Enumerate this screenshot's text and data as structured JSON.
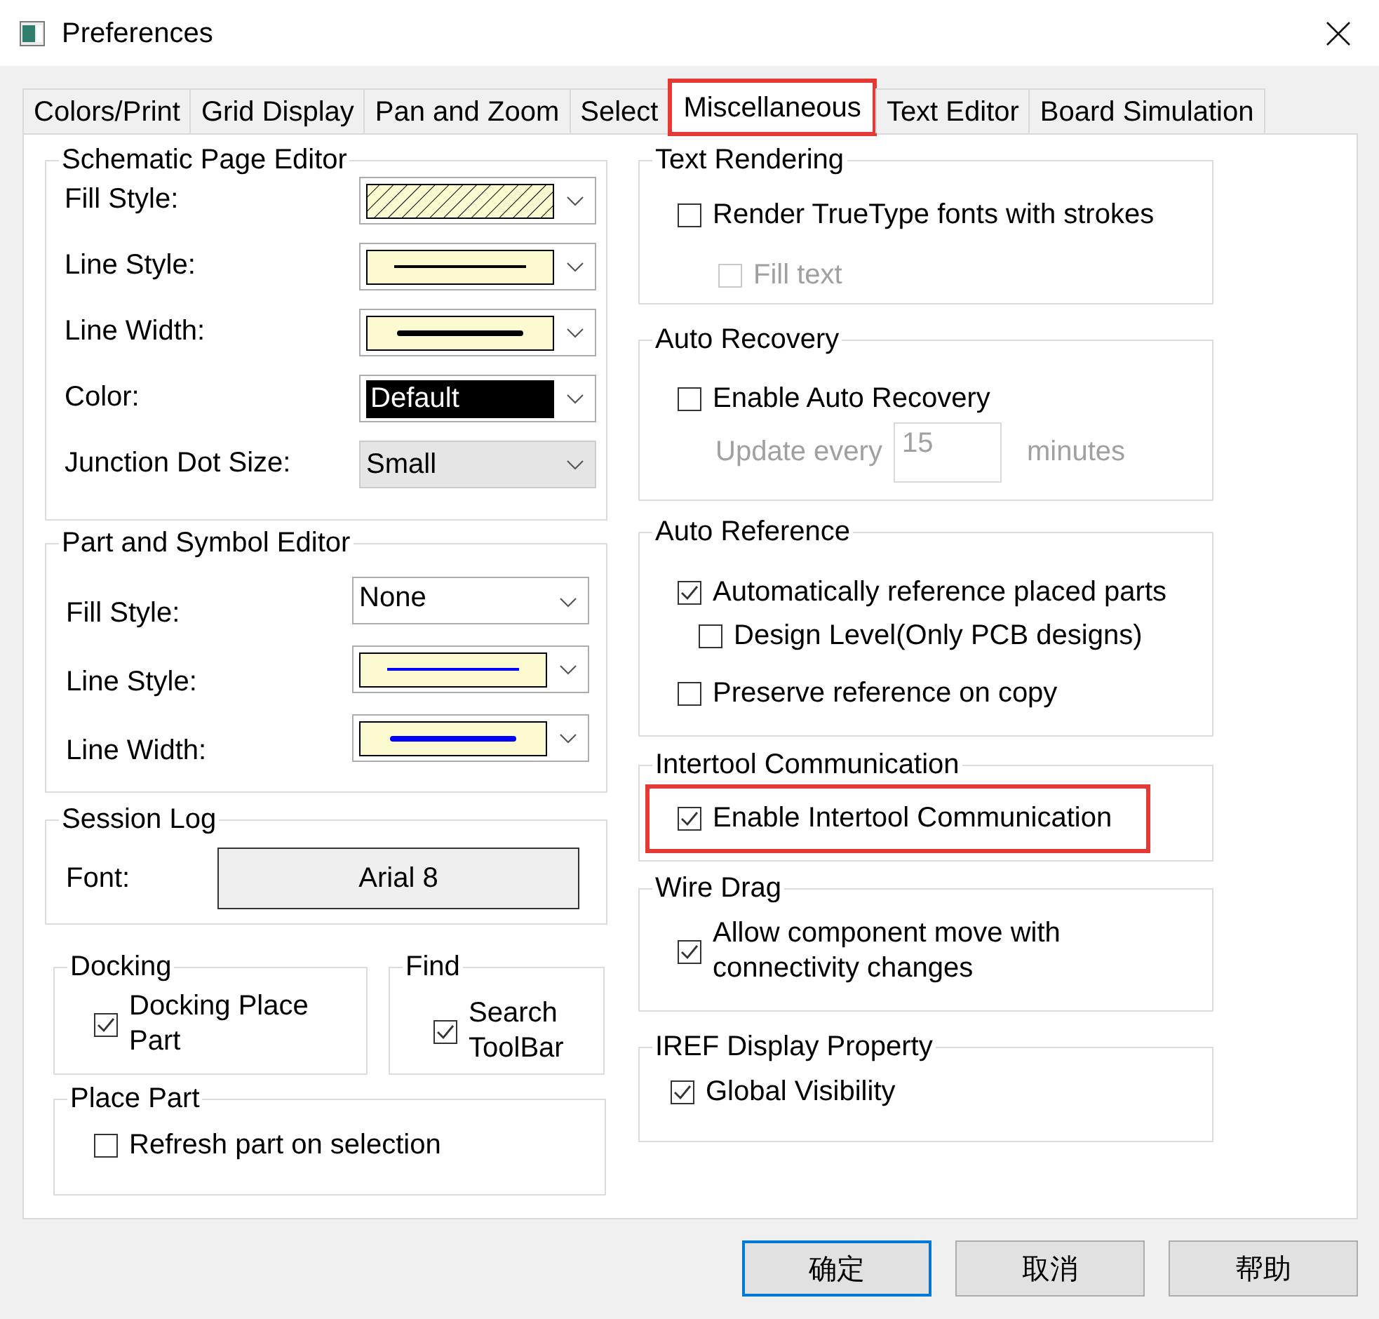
{
  "window": {
    "title": "Preferences"
  },
  "tabs": [
    {
      "label": "Colors/Print",
      "selected": false,
      "highlighted": false
    },
    {
      "label": "Grid Display",
      "selected": false,
      "highlighted": false
    },
    {
      "label": "Pan and Zoom",
      "selected": false,
      "highlighted": false
    },
    {
      "label": "Select",
      "selected": false,
      "highlighted": false
    },
    {
      "label": "Miscellaneous",
      "selected": true,
      "highlighted": true
    },
    {
      "label": "Text Editor",
      "selected": false,
      "highlighted": false
    },
    {
      "label": "Board Simulation",
      "selected": false,
      "highlighted": false
    }
  ],
  "left_column": [
    {
      "title": "Schematic Page Editor",
      "items": [
        {
          "kind": "hatch_combo",
          "label": "Fill Style:",
          "color": "#000000"
        },
        {
          "kind": "thin_line_combo",
          "label": "Line Style:",
          "color": "#000000"
        },
        {
          "kind": "thick_line_combo",
          "label": "Line Width:",
          "color": "#000000"
        },
        {
          "kind": "color_combo",
          "label": "Color:",
          "value": "Default",
          "color": "#000000"
        },
        {
          "kind": "list_combo",
          "label": "Junction Dot Size:",
          "value": "Small"
        }
      ]
    },
    {
      "title": "Part and Symbol Editor",
      "items": [
        {
          "kind": "edit_combo",
          "label": "Fill Style:",
          "value": "None"
        },
        {
          "kind": "thin_line_combo",
          "label": "Line Style:",
          "color": "#0000ff"
        },
        {
          "kind": "thick_line_combo",
          "label": "Line Width:",
          "color": "#0000ff"
        }
      ]
    },
    {
      "title": "Session Log",
      "items": [
        {
          "kind": "font_button",
          "label": "Font:",
          "value": "Arial 8"
        }
      ]
    },
    {
      "groups": [
        {
          "title": "Docking",
          "items": [
            {
              "kind": "checkbox",
              "label": "Docking Place Part",
              "checked": true,
              "disabled": false,
              "highlighted": false
            }
          ]
        },
        {
          "title": "Find",
          "items": [
            {
              "kind": "checkbox",
              "label": "Search ToolBar",
              "checked": true,
              "disabled": false,
              "highlighted": false
            }
          ]
        }
      ]
    },
    {
      "title": "Place Part",
      "items": [
        {
          "kind": "checkbox",
          "label": "Refresh part on selection",
          "checked": false,
          "disabled": false,
          "highlighted": false
        }
      ]
    }
  ],
  "right_column": [
    {
      "title": "Text Rendering",
      "items": [
        {
          "kind": "checkbox",
          "label": "Render TrueType fonts with strokes",
          "checked": false,
          "disabled": false,
          "highlighted": false,
          "children": [
            {
              "kind": "checkbox",
              "label": "Fill text",
              "checked": false,
              "disabled": true,
              "highlighted": false
            }
          ]
        }
      ]
    },
    {
      "title": "Auto Recovery",
      "items": [
        {
          "kind": "checkbox",
          "label": "Enable Auto Recovery",
          "checked": false,
          "disabled": false,
          "highlighted": false,
          "children": [
            {
              "kind": "number_field",
              "label": "Update every",
              "value": "15",
              "unit": "minutes",
              "disabled": true
            }
          ]
        }
      ]
    },
    {
      "title": "Auto Reference",
      "items": [
        {
          "kind": "checkbox",
          "label": "Automatically reference placed parts",
          "checked": true,
          "disabled": false,
          "highlighted": false,
          "children": [
            {
              "kind": "checkbox",
              "label": "Design Level(Only PCB designs)",
              "checked": false,
              "disabled": false,
              "highlighted": false
            }
          ]
        },
        {
          "kind": "checkbox",
          "label": "Preserve reference on copy",
          "checked": false,
          "disabled": false,
          "highlighted": false
        }
      ]
    },
    {
      "title": "Intertool Communication",
      "items": [
        {
          "kind": "checkbox",
          "label": "Enable Intertool Communication",
          "checked": true,
          "disabled": false,
          "highlighted": true
        }
      ]
    },
    {
      "title": "Wire Drag",
      "items": [
        {
          "kind": "checkbox",
          "label": "Allow component move with connectivity changes",
          "checked": true,
          "disabled": false,
          "highlighted": false
        }
      ]
    },
    {
      "title": "IREF Display Property",
      "items": [
        {
          "kind": "checkbox",
          "label": "Global Visibility",
          "checked": true,
          "disabled": false,
          "highlighted": false
        }
      ]
    }
  ],
  "buttons": [
    {
      "label": "确定",
      "default": true
    },
    {
      "label": "取消",
      "default": false
    },
    {
      "label": "帮助",
      "default": false
    }
  ]
}
